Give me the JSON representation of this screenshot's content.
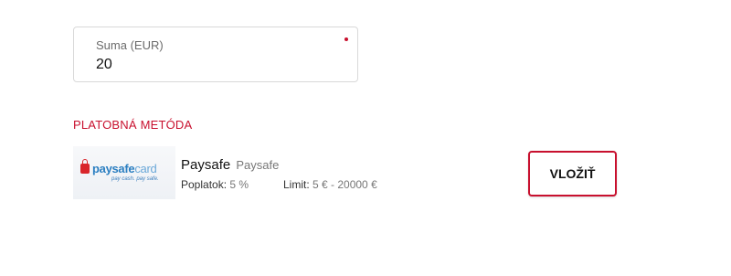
{
  "amount_field": {
    "label": "Suma (EUR)",
    "value": "20"
  },
  "payment_method_section": {
    "title": "PLATOBNÁ METÓDA"
  },
  "method": {
    "logo_text_bold": "paysafe",
    "logo_text_light": "card",
    "logo_tagline": "pay cash. pay safe.",
    "name": "Paysafe",
    "provider": "Paysafe",
    "fee_label": "Poplatok:",
    "fee_value": "5 %",
    "limit_label": "Limit:",
    "limit_value": "5 € - 20000 €"
  },
  "deposit_button": {
    "label": "VLOŽIŤ"
  },
  "colors": {
    "accent": "#c8102e",
    "logo_blue": "#2b7fc1"
  }
}
